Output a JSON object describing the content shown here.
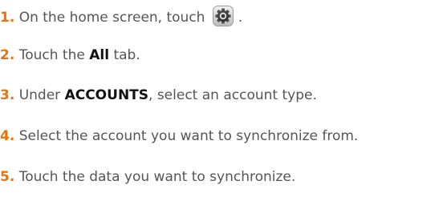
{
  "steps": [
    {
      "number": "1.",
      "before": "On the home screen, touch",
      "icon": "settings-icon",
      "after": "."
    },
    {
      "number": "2.",
      "before": "Touch the",
      "bold": "All",
      "after": "tab."
    },
    {
      "number": "3.",
      "before": "Under",
      "bold": "ACCOUNTS",
      "after": ", select an account type."
    },
    {
      "number": "4.",
      "text": "Select the account you want to synchronize from."
    },
    {
      "number": "5.",
      "text": "Touch the data you want to synchronize."
    }
  ],
  "colors": {
    "number": "#e8720c",
    "text": "#555555",
    "bold": "#111111"
  }
}
